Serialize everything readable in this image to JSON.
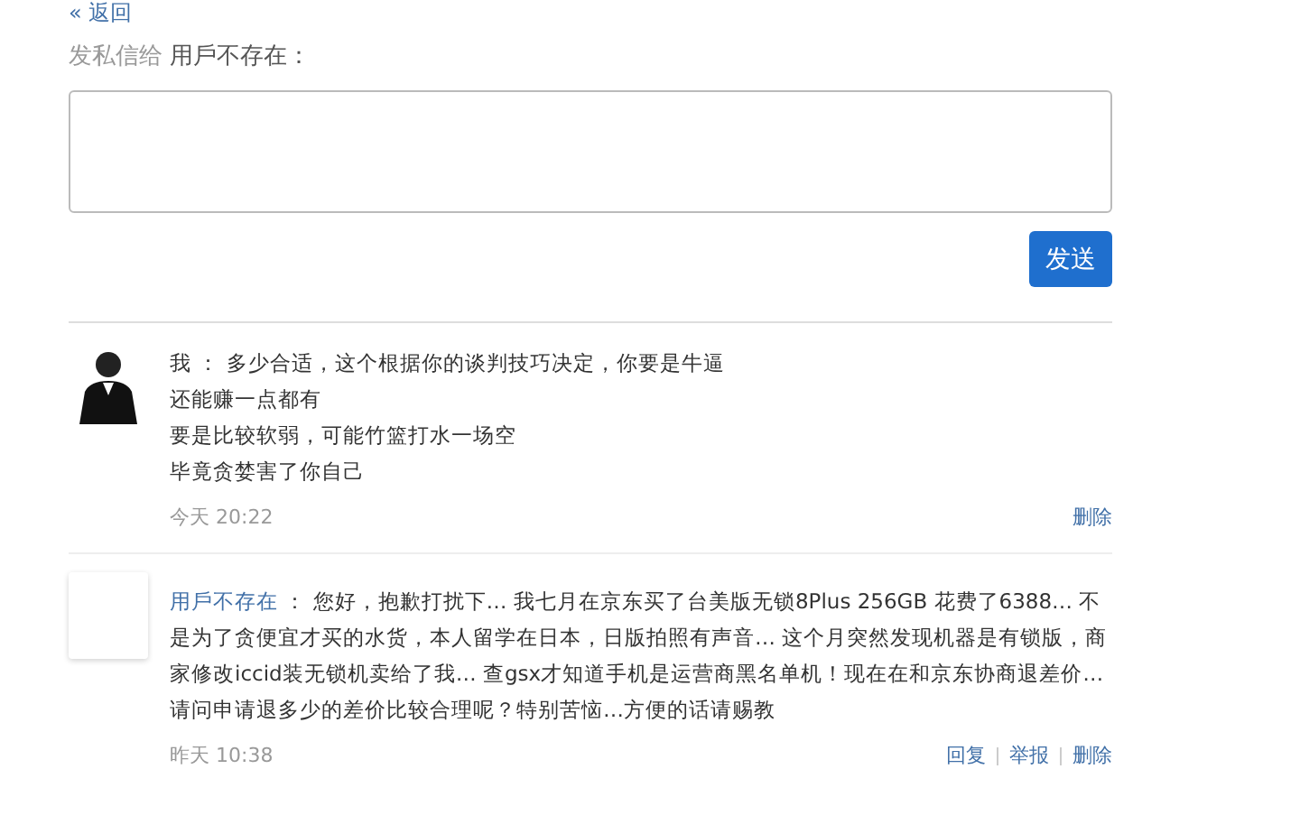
{
  "back_link": "« 返回",
  "compose": {
    "label": "发私信给",
    "recipient": "用戶不存在：",
    "send_button": "发送"
  },
  "messages": [
    {
      "kind": "mine",
      "sender": "我",
      "separator": "：",
      "lines": [
        "多少合适，这个根据你的谈判技巧决定，你要是牛逼",
        "还能赚一点都有",
        "要是比较软弱，可能竹篮打水一场空",
        "毕竟贪婪害了你自己"
      ],
      "time": "今天 20:22",
      "actions": [
        "删除"
      ]
    },
    {
      "kind": "other",
      "sender": "用戶不存在",
      "separator": "：",
      "lines": [
        "您好，抱歉打扰下… 我七月在京东买了台美版无锁8Plus 256GB 花费了6388… 不是为了贪便宜才买的水货，本人留学在日本，日版拍照有声音… 这个月突然发现机器是有锁版，商家修改iccid装无锁机卖给了我… 查gsx才知道手机是运营商黑名单机！现在在和京东协商退差价…请问申请退多少的差价比较合理呢？特别苦恼…方便的话请赐教"
      ],
      "time": "昨天 10:38",
      "actions": [
        "回复",
        "举报",
        "删除"
      ]
    }
  ]
}
